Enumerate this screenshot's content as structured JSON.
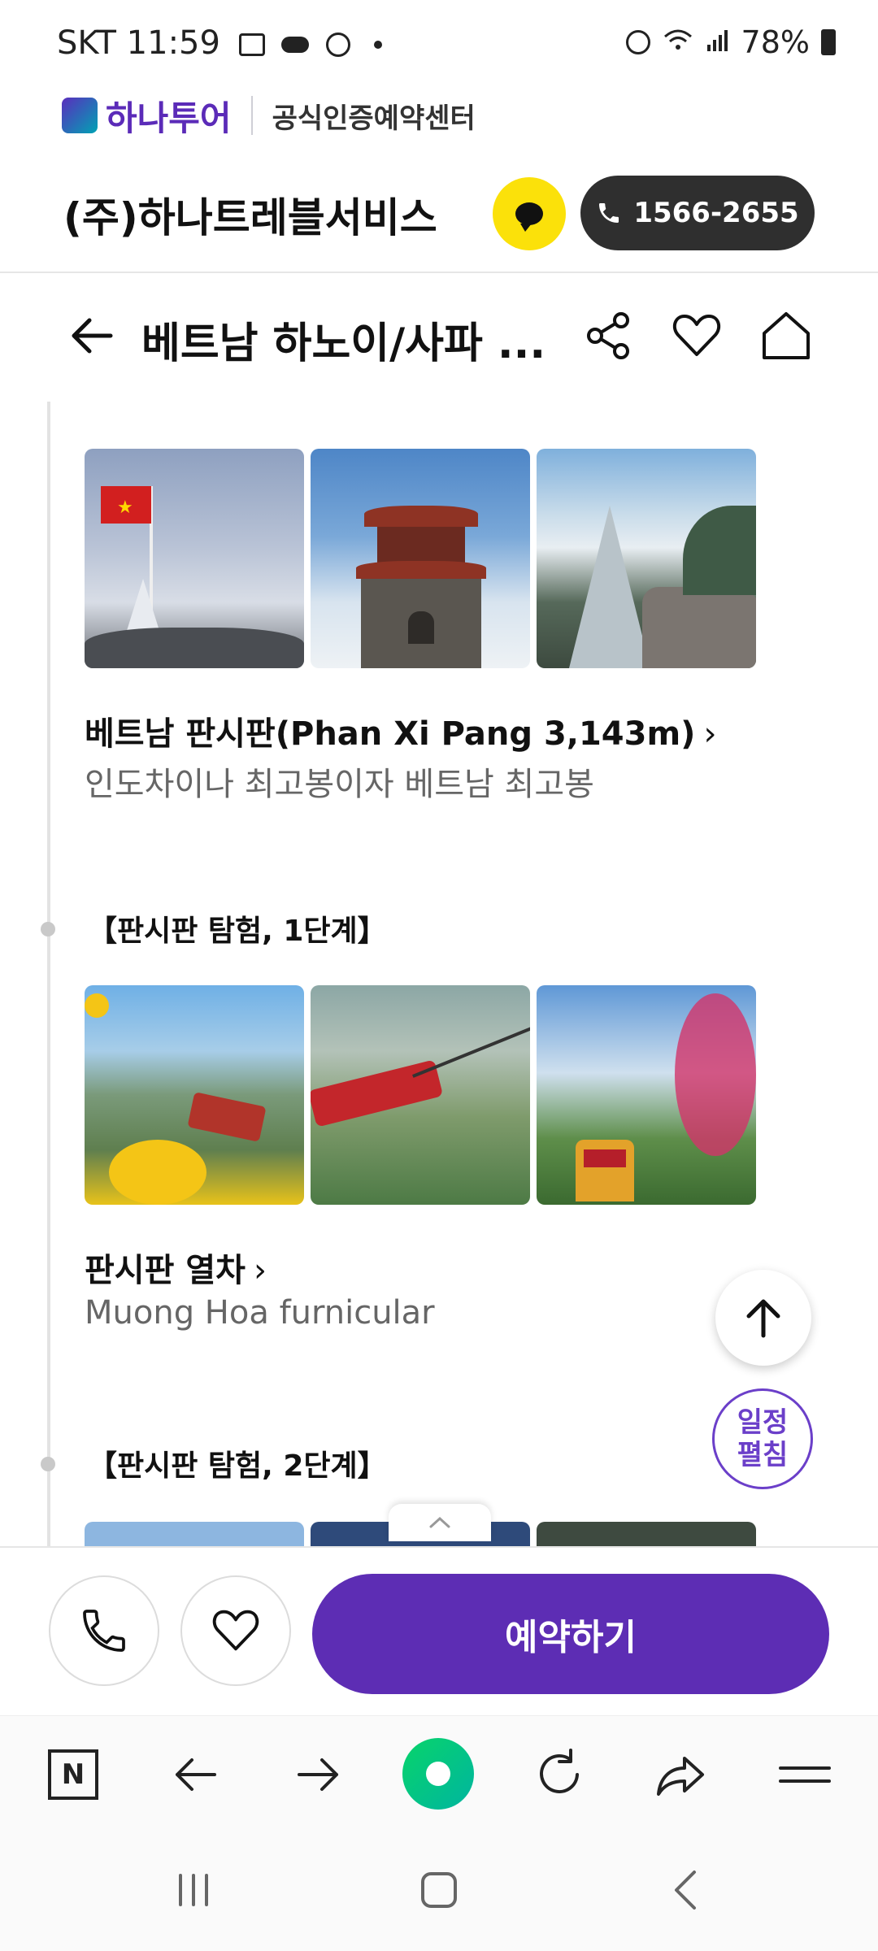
{
  "status_bar": {
    "carrier": "SKT",
    "time": "11:59",
    "battery": "78%"
  },
  "brand": {
    "name": "하나투어",
    "center": "공식인증예약센터"
  },
  "company": {
    "name": "(주)하나트레블서비스",
    "phone": "1566-2655"
  },
  "header": {
    "title": "베트남 하노이/사파 ..."
  },
  "items": [
    {
      "title": "베트남 판시판(Phan Xi Pang 3,143m)",
      "subtitle": "인도차이나 최고봉이자 베트남 최고봉"
    },
    {
      "title": "판시판 열차",
      "subtitle": "Muong Hoa furnicular"
    }
  ],
  "sections": [
    {
      "label": "【판시판 탐험, 1단계】"
    },
    {
      "label": "【판시판 탐험, 2단계】"
    }
  ],
  "floating": {
    "schedule_line1": "일정",
    "schedule_line2": "펼침"
  },
  "actions": {
    "reserve_label": "예약하기"
  },
  "colors": {
    "brand_purple": "#5d2db4",
    "kakao_yellow": "#fbe10a",
    "naver_green": "#03c75a"
  }
}
